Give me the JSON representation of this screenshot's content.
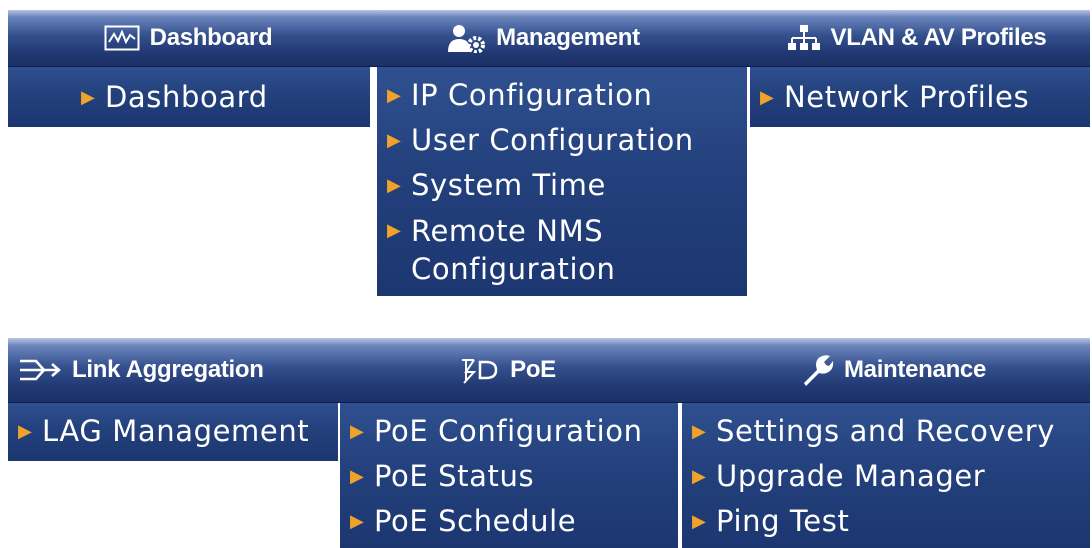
{
  "top": {
    "tabs": [
      {
        "label": "Dashboard",
        "icon": "dashboard-graph-icon"
      },
      {
        "label": "Management",
        "icon": "user-gear-icon"
      },
      {
        "label": "VLAN & AV Profiles",
        "icon": "network-topology-icon"
      }
    ],
    "dashboard_menu": [
      "Dashboard"
    ],
    "management_menu": [
      "IP Configuration",
      "User Configuration",
      "System Time",
      "Remote NMS Configuration"
    ],
    "vlan_menu": [
      "Network Profiles"
    ]
  },
  "bottom": {
    "tabs": [
      {
        "label": "Link Aggregation",
        "icon": "link-aggregation-icon"
      },
      {
        "label": "PoE",
        "icon": "poe-icon"
      },
      {
        "label": "Maintenance",
        "icon": "wrench-icon"
      }
    ],
    "lag_menu": [
      "LAG Management"
    ],
    "poe_menu": [
      "PoE Configuration",
      "PoE Status",
      "PoE Schedule"
    ],
    "maintenance_menu": [
      "Settings and Recovery",
      "Upgrade Manager",
      "Ping Test"
    ]
  },
  "colors": {
    "bar": "#2a4582",
    "menu": "#24427e",
    "arrow": "#f0a22a",
    "text": "#ffffff"
  }
}
